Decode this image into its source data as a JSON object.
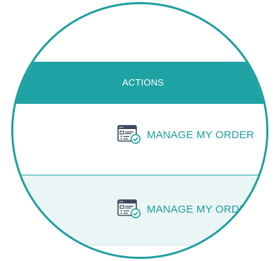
{
  "table": {
    "header": {
      "actions_label": "ACTIONS"
    },
    "rows": [
      {
        "action_label": "MANAGE MY ORDER",
        "icon": "order-checklist-icon"
      },
      {
        "action_label": "MANAGE MY ORDER",
        "icon": "order-checklist-icon"
      }
    ]
  },
  "colors": {
    "accent": "#1fa2a3",
    "row_alt_bg": "#eaf5f6",
    "lens_border": "#1e9ea0"
  }
}
